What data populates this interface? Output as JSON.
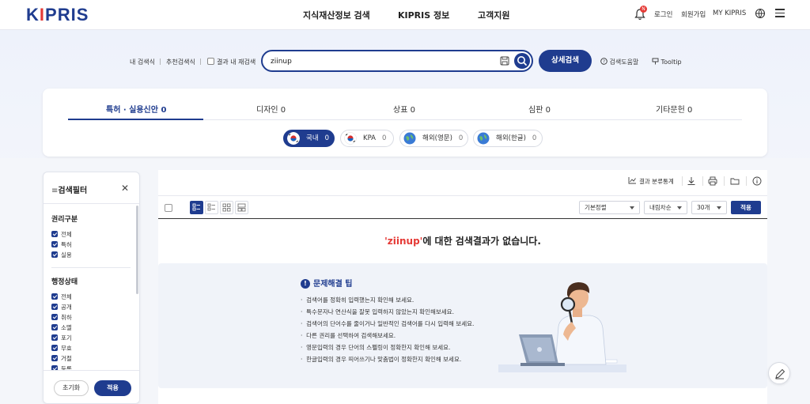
{
  "header": {
    "logo": "KIPRIS",
    "nav": [
      "지식재산정보 검색",
      "KIPRIS 정보",
      "고객지원"
    ],
    "notification_count": "N",
    "links": [
      "로그인",
      "회원가입",
      "MY KIPRIS"
    ]
  },
  "search": {
    "my_search": "내 검색식",
    "recommend_search": "추천검색식",
    "re_search_label": "결과 내 재검색",
    "query": "ziinup",
    "advanced_label": "상세검색",
    "help_label": "검색도움말",
    "tooltip_label": "Tooltip"
  },
  "tabs": [
    {
      "label": "특허 · 실용신안",
      "count": "0"
    },
    {
      "label": "디자인",
      "count": "0"
    },
    {
      "label": "상표",
      "count": "0"
    },
    {
      "label": "심판",
      "count": "0"
    },
    {
      "label": "기타문헌",
      "count": "0"
    }
  ],
  "sub_tabs": [
    {
      "label": "국내",
      "count": "0"
    },
    {
      "label": "KPA",
      "count": "0"
    },
    {
      "label": "해외(영문)",
      "count": "0"
    },
    {
      "label": "해외(한글)",
      "count": "0"
    }
  ],
  "filter": {
    "title": "검색필터",
    "sections": [
      {
        "title": "권리구분",
        "items": [
          "전체",
          "특허",
          "실용"
        ]
      },
      {
        "title": "행정상태",
        "items": [
          "전체",
          "공개",
          "취하",
          "소멸",
          "포기",
          "무효",
          "거절",
          "등록"
        ]
      }
    ],
    "reset_label": "초기화",
    "apply_label": "적용"
  },
  "results": {
    "stats_label": "결과 분류통계",
    "sort_select": "기본정렬",
    "order_select": "내림차순",
    "per_page_select": "30개",
    "apply_label": "적용",
    "no_result_keyword": "'ziinup'",
    "no_result_suffix": "에 대한 검색결과가 없습니다.",
    "tips_title": "문제해결 팁",
    "tips": [
      "검색어를 정확히 입력했는지 확인해 보세요.",
      "특수문자나 연산식을 잘못 입력하지 않았는지 확인해보세요.",
      "검색어의 단어수를 줄이거나 일반적인 검색어를 다시 입력해 보세요.",
      "다른 권리를 선택하여 검색해보세요.",
      "영문입력의 경우 단어의 스펠링이 정확한지 확인해 보세요.",
      "한글입력의 경우 띄어쓰기나 맞춤법이 정확한지 확인해 보세요."
    ]
  },
  "colors": {
    "primary": "#1f3c8f",
    "accent": "#e53935"
  }
}
